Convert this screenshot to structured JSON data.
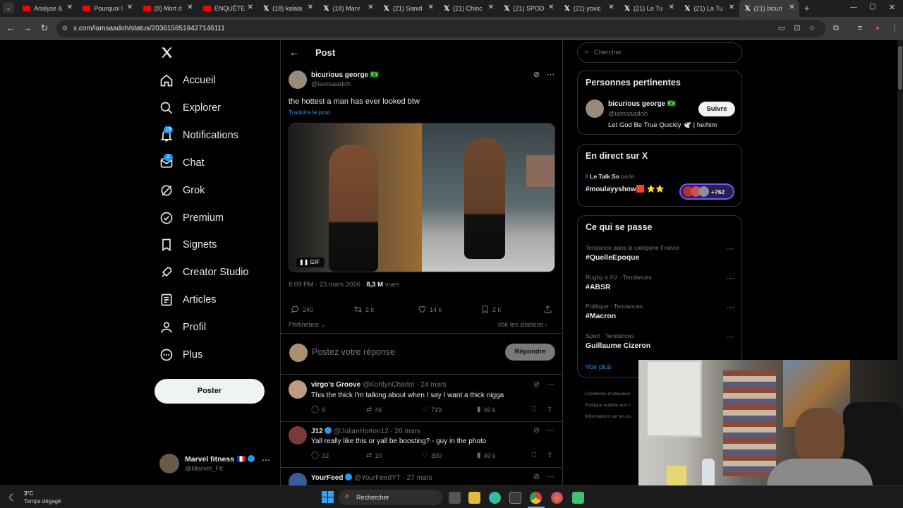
{
  "browser": {
    "tabs": [
      {
        "title": "Analyse &",
        "icon": "youtube-icon"
      },
      {
        "title": "Pourquoi l",
        "icon": "youtube-icon"
      },
      {
        "title": "(8) Mort d",
        "icon": "youtube-icon"
      },
      {
        "title": "ENQUÊTE",
        "icon": "youtube-icon"
      },
      {
        "title": "(18) kalala",
        "icon": "x-icon"
      },
      {
        "title": "(18) Marv",
        "icon": "x-icon"
      },
      {
        "title": "(21) Sanid",
        "icon": "x-icon"
      },
      {
        "title": "(21) Chinc",
        "icon": "x-icon"
      },
      {
        "title": "(21) SPOD",
        "icon": "x-icon"
      },
      {
        "title": "(21) yoxic",
        "icon": "x-icon"
      },
      {
        "title": "(21) La Tu",
        "icon": "x-icon"
      },
      {
        "title": "(21) La Tu",
        "icon": "x-icon"
      },
      {
        "title": "(21) bicuri",
        "icon": "x-icon"
      }
    ],
    "url": "x.com/iamsaadoh/status/2036158519427146111"
  },
  "sidebar": {
    "items": [
      {
        "label": "Accueil",
        "icon": "home-icon"
      },
      {
        "label": "Explorer",
        "icon": "search-icon"
      },
      {
        "label": "Notifications",
        "icon": "bell-icon",
        "badge": "19"
      },
      {
        "label": "Chat",
        "icon": "mail-icon",
        "badge": "2"
      },
      {
        "label": "Grok",
        "icon": "grok-icon"
      },
      {
        "label": "Premium",
        "icon": "verified-icon"
      },
      {
        "label": "Signets",
        "icon": "bookmark-icon"
      },
      {
        "label": "Creator Studio",
        "icon": "rocket-icon"
      },
      {
        "label": "Articles",
        "icon": "article-icon"
      },
      {
        "label": "Profil",
        "icon": "person-icon"
      },
      {
        "label": "Plus",
        "icon": "more-circle-icon"
      }
    ],
    "post_button": "Poster",
    "account": {
      "name": "Marvel fitness",
      "flag": "🇫🇷",
      "handle": "@Marvel_Fit"
    }
  },
  "post": {
    "header_title": "Post",
    "author_name": "bicurious george",
    "author_flag": "🇧🇷",
    "author_handle": "@iamsaadoh",
    "text": "the hottest a man has ever looked btw",
    "translate": "Traduire le post",
    "media_label": "GIF",
    "time": "8:09 PM · 23 mars 2026 ·",
    "views": "8,3 M",
    "views_label": "vues",
    "stats": {
      "replies": "240",
      "reposts": "2 k",
      "likes": "14 k",
      "bookmarks": "2 k"
    },
    "sort_label": "Pertinence",
    "quotes_link": "Voir les citations",
    "reply_placeholder": "Postez votre réponse",
    "reply_button": "Répondre"
  },
  "replies": [
    {
      "name": "virgo's Groove",
      "handle": "@KortlynCharlot",
      "time": "· 24 mars",
      "text": "This the thick I'm talking about when I say I want a thick nigga",
      "replies": "6",
      "reposts": "46",
      "likes": "719",
      "views": "49 k",
      "verified": false
    },
    {
      "name": "J12",
      "handle": "@JulianHorton12",
      "time": "· 26 mars",
      "text": "Yall really like this or yall be boosting? - guy in the photo",
      "replies": "32",
      "reposts": "10",
      "likes": "390",
      "views": "49 k",
      "verified": true
    },
    {
      "name": "YourFeed",
      "handle": "@YourFeedYT",
      "time": "· 27 mars",
      "text": "",
      "verified": true
    }
  ],
  "right": {
    "search_placeholder": "Chercher",
    "relevant": {
      "title": "Personnes pertinentes",
      "name": "bicurious george",
      "flag": "🇧🇷",
      "handle": "@iamsaadoh",
      "follow": "Suivre",
      "bio": "Let God Be True Quickly 🕊️ | he/him"
    },
    "live": {
      "title": "En direct sur X",
      "host": "Le Talk So",
      "host_suffix": "parle.",
      "show": "#moulayyshow🟥 ⭐⭐",
      "count": "+762"
    },
    "trends": {
      "title": "Ce qui se passe",
      "items": [
        {
          "meta": "Tendance dans la catégorie France",
          "title": "#QuelleEpoque"
        },
        {
          "meta": "Rugby à XV · Tendances",
          "title": "#ABSR"
        },
        {
          "meta": "Politique · Tendances",
          "title": "#Macron"
        },
        {
          "meta": "Sport · Tendances",
          "title": "Guillaume Cizeron"
        }
      ],
      "more": "Voir plus"
    },
    "footer": [
      "Conditions d'utilisation",
      "Politique relative aux c",
      "Informations sur les pu"
    ]
  },
  "taskbar": {
    "weather_temp": "3°C",
    "weather_desc": "Temps dégagé",
    "search": "Rechercher"
  },
  "colors": {
    "accent": "#1d9bf0",
    "background": "#000000",
    "border": "#2f3336",
    "muted": "#71767b"
  }
}
